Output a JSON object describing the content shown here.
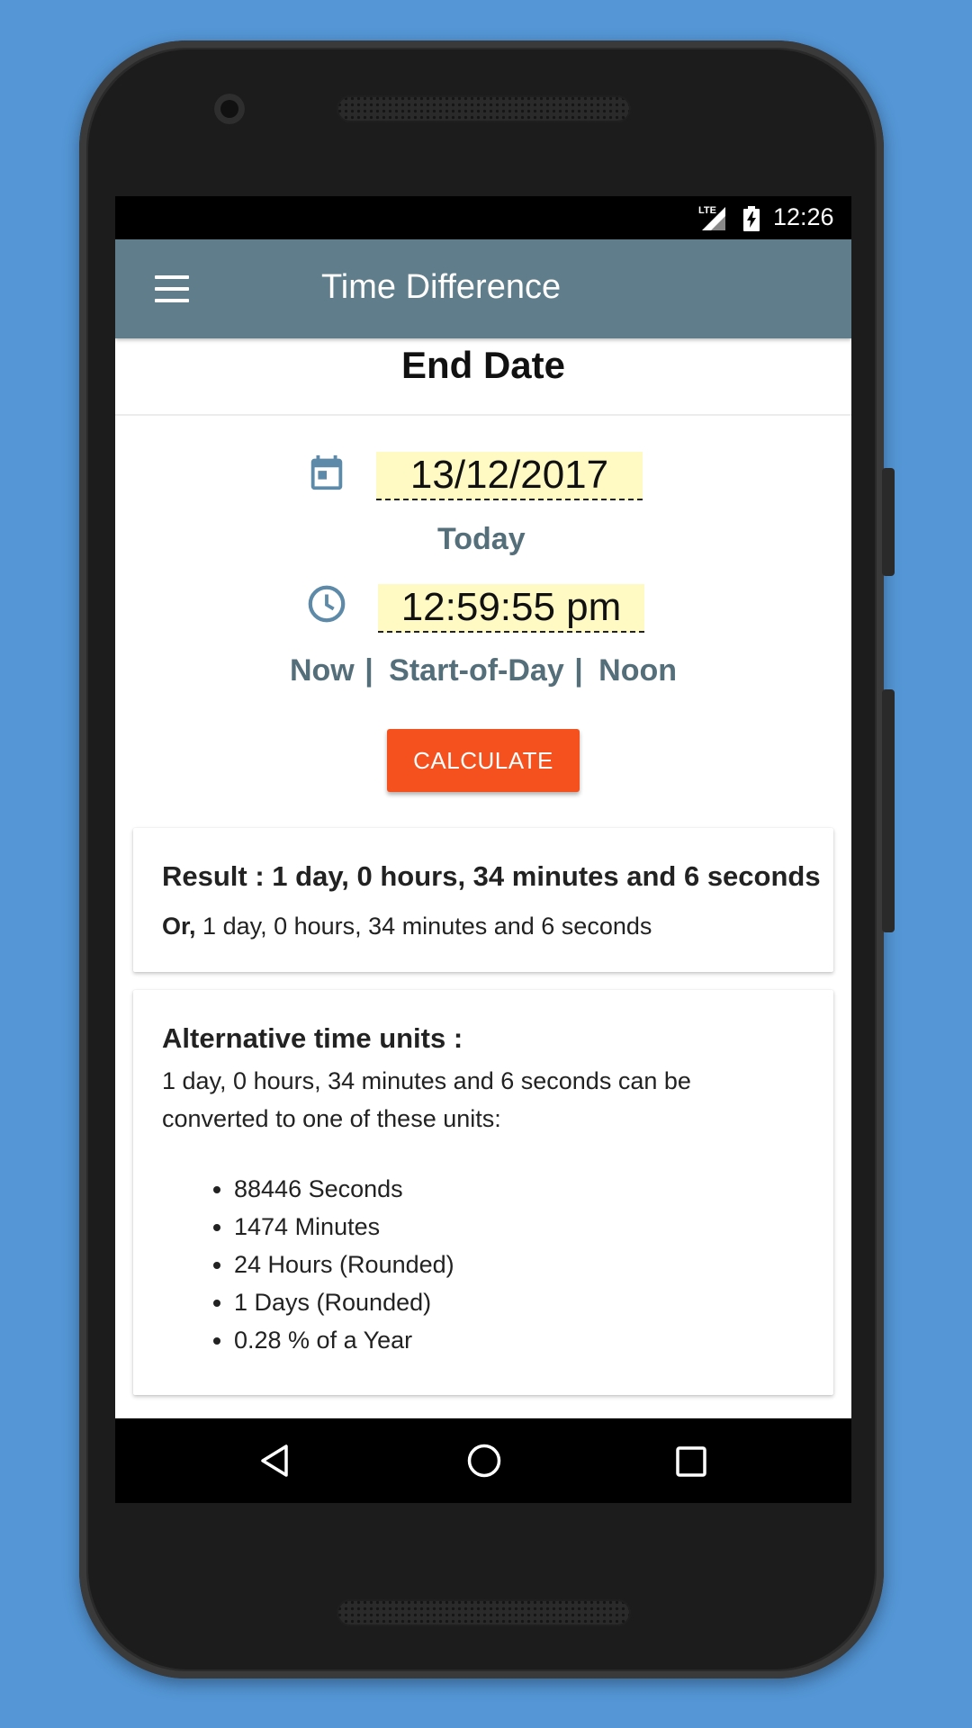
{
  "status_bar": {
    "network": "LTE",
    "time": "12:26"
  },
  "app_bar": {
    "menu_icon": "menu-icon",
    "title": "Time Difference"
  },
  "section": {
    "title": "End Date"
  },
  "date_input": {
    "icon": "calendar-icon",
    "value": "13/12/2017",
    "today_label": "Today"
  },
  "time_input": {
    "icon": "clock-icon",
    "value": "12:59:55 pm",
    "quick_links": [
      {
        "label": "Now"
      },
      {
        "label": "Start-of-Day"
      },
      {
        "label": "Noon"
      }
    ],
    "separator": "|"
  },
  "calculate_button": {
    "label": "CALCULATE",
    "color": "#f4511e"
  },
  "result": {
    "main": "Result : 1 day, 0 hours, 34 minutes and 6 seconds",
    "or_prefix": "Or,",
    "or_text": "1 day, 0 hours, 34 minutes and 6 seconds"
  },
  "alternative": {
    "title": "Alternative time units :",
    "description": "1 day, 0 hours, 34 minutes and 6 seconds can be converted to one of these units:",
    "items": [
      "88446 Seconds",
      "1474 Minutes",
      "24 Hours (Rounded)",
      "1 Days (Rounded)",
      "0.28 % of a Year"
    ]
  },
  "nav_bar": {
    "back_icon": "back-icon",
    "home_icon": "home-icon",
    "recents_icon": "recents-icon"
  },
  "colors": {
    "app_bar": "#607d8b",
    "link": "#546e7a",
    "field_bg": "#fff9c4",
    "background": "#5496d6"
  }
}
